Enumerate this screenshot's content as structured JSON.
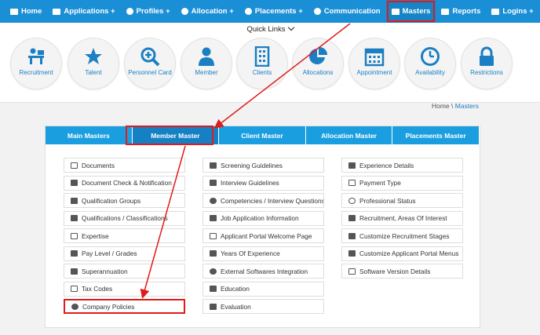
{
  "nav": {
    "items": [
      {
        "label": "Home",
        "icon": "home-icon"
      },
      {
        "label": "Applications +",
        "icon": "list-icon"
      },
      {
        "label": "Profiles +",
        "icon": "user-icon"
      },
      {
        "label": "Allocation +",
        "icon": "pie-icon"
      },
      {
        "label": "Placements +",
        "icon": "globe-icon"
      },
      {
        "label": "Communication",
        "icon": "comments-icon"
      },
      {
        "label": "Masters",
        "icon": "folder-open-icon"
      },
      {
        "label": "Reports",
        "icon": "folder-open-icon"
      },
      {
        "label": "Logins +",
        "icon": "lock-icon"
      }
    ],
    "active": "Masters"
  },
  "quick_links": {
    "title": "Quick Links",
    "items": [
      {
        "label": "Recruitment",
        "icon": "recruitment-icon"
      },
      {
        "label": "Talent",
        "icon": "star-icon"
      },
      {
        "label": "Personnel Card",
        "icon": "search-plus-icon"
      },
      {
        "label": "Member",
        "icon": "user-icon"
      },
      {
        "label": "Clients",
        "icon": "building-icon"
      },
      {
        "label": "Allocations",
        "icon": "pie-chart-icon"
      },
      {
        "label": "Appointment",
        "icon": "calendar-icon"
      },
      {
        "label": "Availability",
        "icon": "clock-icon"
      },
      {
        "label": "Restrictions",
        "icon": "lock-icon"
      }
    ]
  },
  "breadcrumb": {
    "home": "Home \\",
    "current": "Masters"
  },
  "tabs": [
    "Main Masters",
    "Member Master",
    "Client Master",
    "Allocation Master",
    "Placements Master"
  ],
  "active_tab": "Member Master",
  "columns": [
    [
      {
        "label": "Documents",
        "icon": "folder-outline-icon"
      },
      {
        "label": "Document Check & Notification",
        "icon": "check-square-icon"
      },
      {
        "label": "Qualification Groups",
        "icon": "graduation-cap-icon"
      },
      {
        "label": "Qualifications / Classifications",
        "icon": "graduation-cap-icon"
      },
      {
        "label": "Expertise",
        "icon": "lightbulb-icon"
      },
      {
        "label": "Pay Level / Grades",
        "icon": "credit-card-icon"
      },
      {
        "label": "Superannuation",
        "icon": "money-icon"
      },
      {
        "label": "Tax Codes",
        "icon": "folder-open-icon"
      },
      {
        "label": "Company Policies",
        "icon": "check-circle-icon"
      }
    ],
    [
      {
        "label": "Screening Guidelines",
        "icon": "cogs-icon"
      },
      {
        "label": "Interview Guidelines",
        "icon": "folder-open-icon"
      },
      {
        "label": "Competencies / Interview Questions",
        "icon": "question-circle-icon"
      },
      {
        "label": "Job Application Information",
        "icon": "file-icon"
      },
      {
        "label": "Applicant Portal Welcome Page",
        "icon": "desktop-icon"
      },
      {
        "label": "Years Of Experience",
        "icon": "graduation-cap-icon"
      },
      {
        "label": "External Softwares Integration",
        "icon": "cog-icon"
      },
      {
        "label": "Education",
        "icon": "folder-open-icon"
      },
      {
        "label": "Evaluation",
        "icon": "check-square-icon"
      }
    ],
    [
      {
        "label": "Experience Details",
        "icon": "user-tie-icon"
      },
      {
        "label": "Payment Type",
        "icon": "money-icon"
      },
      {
        "label": "Professional Status",
        "icon": "user-outline-icon"
      },
      {
        "label": "Recruitment, Areas Of Interest",
        "icon": "check-icon"
      },
      {
        "label": "Customize Recruitment Stages",
        "icon": "briefcase-icon"
      },
      {
        "label": "Customize Applicant Portal Menus",
        "icon": "bars-icon"
      },
      {
        "label": "Software Version Details",
        "icon": "desktop-icon"
      }
    ]
  ],
  "colors": {
    "nav": "#1a8fd6",
    "tab": "#1a9ee0",
    "tab_active": "#1580c4",
    "highlight": "#e01b1b",
    "link": "#1a7fc3"
  }
}
